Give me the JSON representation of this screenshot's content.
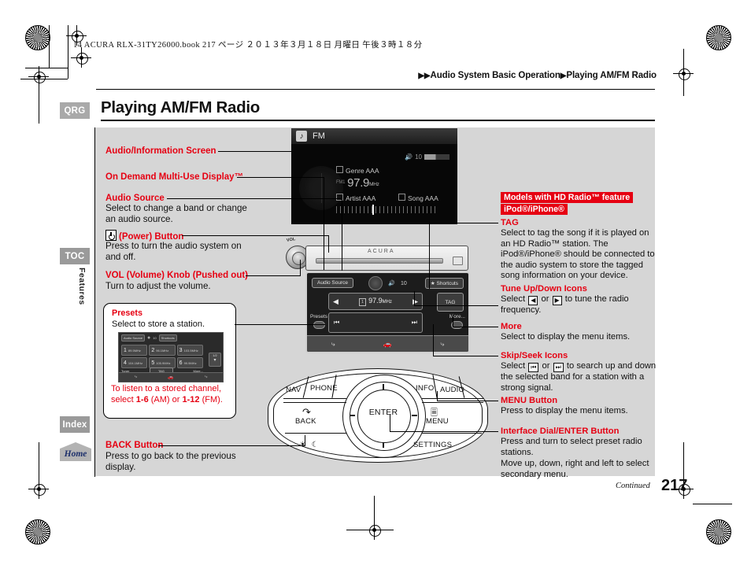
{
  "print": {
    "book_line": "14 ACURA RLX-31TY26000.book   217 ページ   ２０１３年３月１８日   月曜日   午後３時１８分"
  },
  "header": {
    "breadcrumb_1": "Audio System Basic Operation",
    "breadcrumb_2": "Playing AM/FM Radio",
    "page_title": "Playing AM/FM Radio",
    "qrg_tab": "QRG"
  },
  "sidebar": {
    "toc": "TOC",
    "features": "Features",
    "index": "Index",
    "home": "Home"
  },
  "left_callouts": {
    "screen_label": "Audio/Information Screen",
    "odmd_label": "On Demand Multi-Use Display™",
    "audio_source_label": "Audio Source",
    "audio_source_text": "Select to change a band or change an audio source.",
    "power_label": "(Power) Button",
    "power_text": "Press to turn the audio system on and off.",
    "vol_label": "VOL (Volume) Knob (Pushed out)",
    "vol_text": "Turn to adjust the volume.",
    "back_label": "BACK Button",
    "back_text": "Press to go back to the previous display."
  },
  "presets_callout": {
    "title": "Presets",
    "subtitle": "Select to store a station.",
    "note_line1": "To listen to a stored channel,",
    "note_line2_a": "select ",
    "note_line2_b": "1-6",
    "note_line2_c": " (AM) or ",
    "note_line2_d": "1-12",
    "note_line2_e": " (FM).",
    "screen": {
      "audio_source": "Audio Source",
      "volume": "10",
      "shortcuts": "Shortcuts",
      "presets": [
        {
          "num": "1",
          "freq": "89.5MHz"
        },
        {
          "num": "2",
          "freq": "96.1MHz"
        },
        {
          "num": "3",
          "freq": "103.5MHz"
        },
        {
          "num": "4",
          "freq": "104.1MHz"
        },
        {
          "num": "5",
          "freq": "105.9MHz"
        },
        {
          "num": "6",
          "freq": "99.9MHz"
        }
      ],
      "page_indicator": "1/2",
      "tuner": "Tuner",
      "tag": "TAG",
      "more": "More..."
    }
  },
  "right_callouts": {
    "badge_1": "Models with HD Radio™ feature",
    "badge_2": "iPod®/iPhone®",
    "tag_label": "TAG",
    "tag_text": "Select to tag the song if it is played on an HD Radio™ station. The iPod®/iPhone® should be connected to the audio system to store the tagged song information on your device.",
    "tune_label": "Tune Up/Down Icons",
    "tune_text_a": "Select ",
    "tune_icon_left": "◀",
    "tune_text_b": " or ",
    "tune_icon_right": "▶",
    "tune_text_c": " to tune the radio frequency.",
    "more_label": "More",
    "more_text": "Select to display the menu items.",
    "skip_label": "Skip/Seek Icons",
    "skip_text_a": "Select ",
    "skip_icon_left": "⏮",
    "skip_text_b": " or ",
    "skip_icon_right": "⏭",
    "skip_text_c": " to search up and down the selected band for a station with a strong signal.",
    "menu_label": "MENU Button",
    "menu_text": "Press to display the menu items.",
    "dial_label": "Interface Dial/ENTER Button",
    "dial_text_1": "Press and turn to select preset radio stations.",
    "dial_text_2": "Move up, down, right and left to select secondary menu."
  },
  "audio_screen": {
    "band": "FM",
    "volume": "10",
    "genre": "Genre AAA",
    "freq_prefix": "FM1",
    "frequency": "97.9",
    "freq_unit": "MHz",
    "artist": "Artist AAA",
    "song": "Song AAA"
  },
  "odmd": {
    "audio_source": "Audio Source",
    "volume": "10",
    "shortcuts": "Shortcuts",
    "freq_indicator": "1",
    "frequency": "97.9",
    "freq_unit": "MHz",
    "tag": "TAG",
    "presets": "Presets",
    "more": "More...",
    "tune_left": "◀",
    "tune_right": "▶",
    "skip_left": "⏮",
    "skip_right": "⏭"
  },
  "faceplate": {
    "brand": "ACURA",
    "vol": "VOL",
    "power_glyph": "⏻"
  },
  "controller": {
    "nav": "NAV",
    "phone": "PHONE",
    "info": "INFO",
    "audio": "AUDIO",
    "back": "BACK",
    "enter": "ENTER",
    "menu": "MENU",
    "settings": "SETTINGS",
    "brightness_glyphs": "☀ ☾"
  },
  "footer": {
    "continued": "Continued",
    "page_number": "217"
  },
  "colors": {
    "accent_red": "#e60012",
    "panel_grey": "#d6d6d6",
    "tab_grey": "#9a9a9a"
  }
}
